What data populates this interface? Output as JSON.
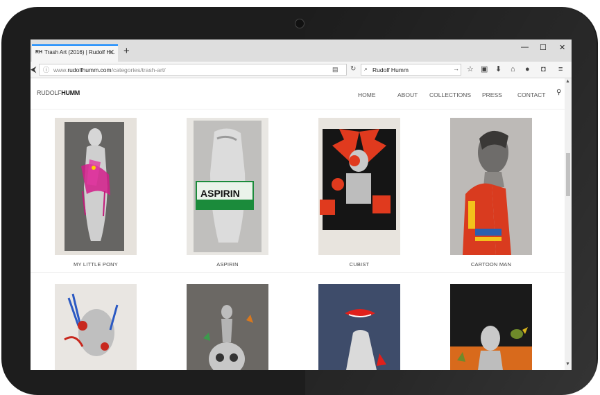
{
  "browser": {
    "tab_title": "Trash Art (2016) | Rudolf H...",
    "tab_favicon": "RH",
    "url_prefix": "www.",
    "url_domain": "rudolfhumm.com",
    "url_path": "/categories/trash-art/",
    "search_value": "Rudolf Humm"
  },
  "site": {
    "logo_light": "RUDOLF",
    "logo_bold": "HUMM",
    "menu": [
      "HOME",
      "ABOUT",
      "COLLECTIONS",
      "PRESS",
      "CONTACT"
    ]
  },
  "gallery": {
    "row1": [
      "MY LITTLE PONY",
      "ASPIRIN",
      "CUBIST",
      "CARTOON MAN"
    ]
  },
  "artwork_text": {
    "aspirin_brand": "ASPIRIN"
  },
  "colors": {
    "accent_red": "#e03a1e",
    "tab_accent": "#0a84ff"
  },
  "icons": [
    "back-icon",
    "info-icon",
    "reader-icon",
    "reload-icon",
    "search-icon",
    "forward-arrow-icon",
    "bookmark-star-icon",
    "reading-list-icon",
    "download-icon",
    "home-icon",
    "chat-icon",
    "pocket-icon",
    "hamburger-menu-icon"
  ]
}
